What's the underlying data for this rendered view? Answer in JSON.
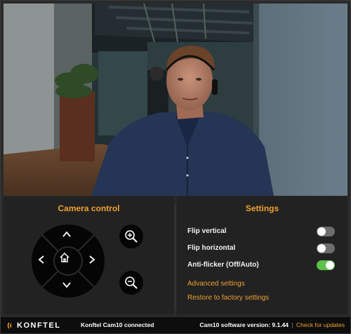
{
  "camera_control": {
    "title": "Camera control",
    "pad_icons": [
      "chevron-up-icon",
      "chevron-down-icon",
      "chevron-left-icon",
      "chevron-right-icon",
      "home-icon"
    ],
    "zoom_icons": [
      "zoom-in-icon",
      "zoom-out-icon"
    ]
  },
  "settings": {
    "title": "Settings",
    "flip_vertical": {
      "label": "Flip vertical",
      "on": false
    },
    "flip_horizontal": {
      "label": "Flip horizontal",
      "on": false
    },
    "anti_flicker": {
      "label": "Anti-flicker (Off/Auto)",
      "on": true
    },
    "advanced_link": "Advanced settings",
    "reset_link": "Restore to factory settings"
  },
  "footer": {
    "logo_text": "KONFTEL",
    "status": "Konftel Cam10 connected",
    "version": "Cam10 software version: 9.1.44",
    "separator": "|",
    "update_link": "Check for updates"
  },
  "colors": {
    "accent": "#f0a030",
    "toggle_on": "#5cc04a",
    "toggle_off": "#6e6e6e",
    "panel_bg": "#222222",
    "footer_bg": "#0d0d0d"
  }
}
